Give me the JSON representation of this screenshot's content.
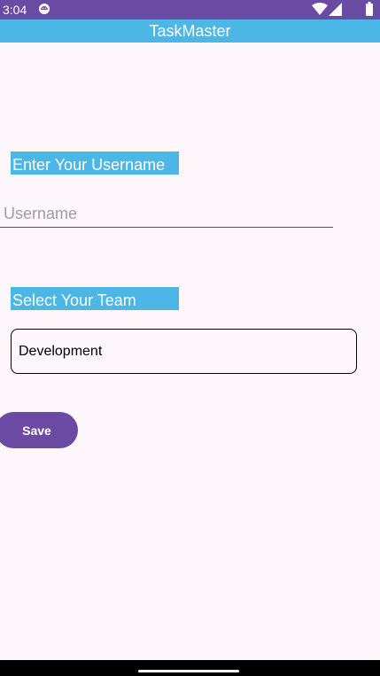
{
  "status_bar": {
    "time": "3:04",
    "app_icon": "android-face-icon",
    "wifi_icon": "wifi-icon",
    "signal_icon": "cell-signal-icon",
    "battery_icon": "battery-icon",
    "background_color": "#6a4aa3"
  },
  "app_bar": {
    "title": "TaskMaster",
    "background_color": "#4cb6e6"
  },
  "username": {
    "label": "Enter Your Username",
    "placeholder": "Username",
    "value": ""
  },
  "team": {
    "label": "Select Your Team",
    "selected": "Development"
  },
  "actions": {
    "save_label": "Save",
    "button_color": "#6a4aa3"
  },
  "nav_bar": {
    "home_indicator": "home-indicator"
  }
}
